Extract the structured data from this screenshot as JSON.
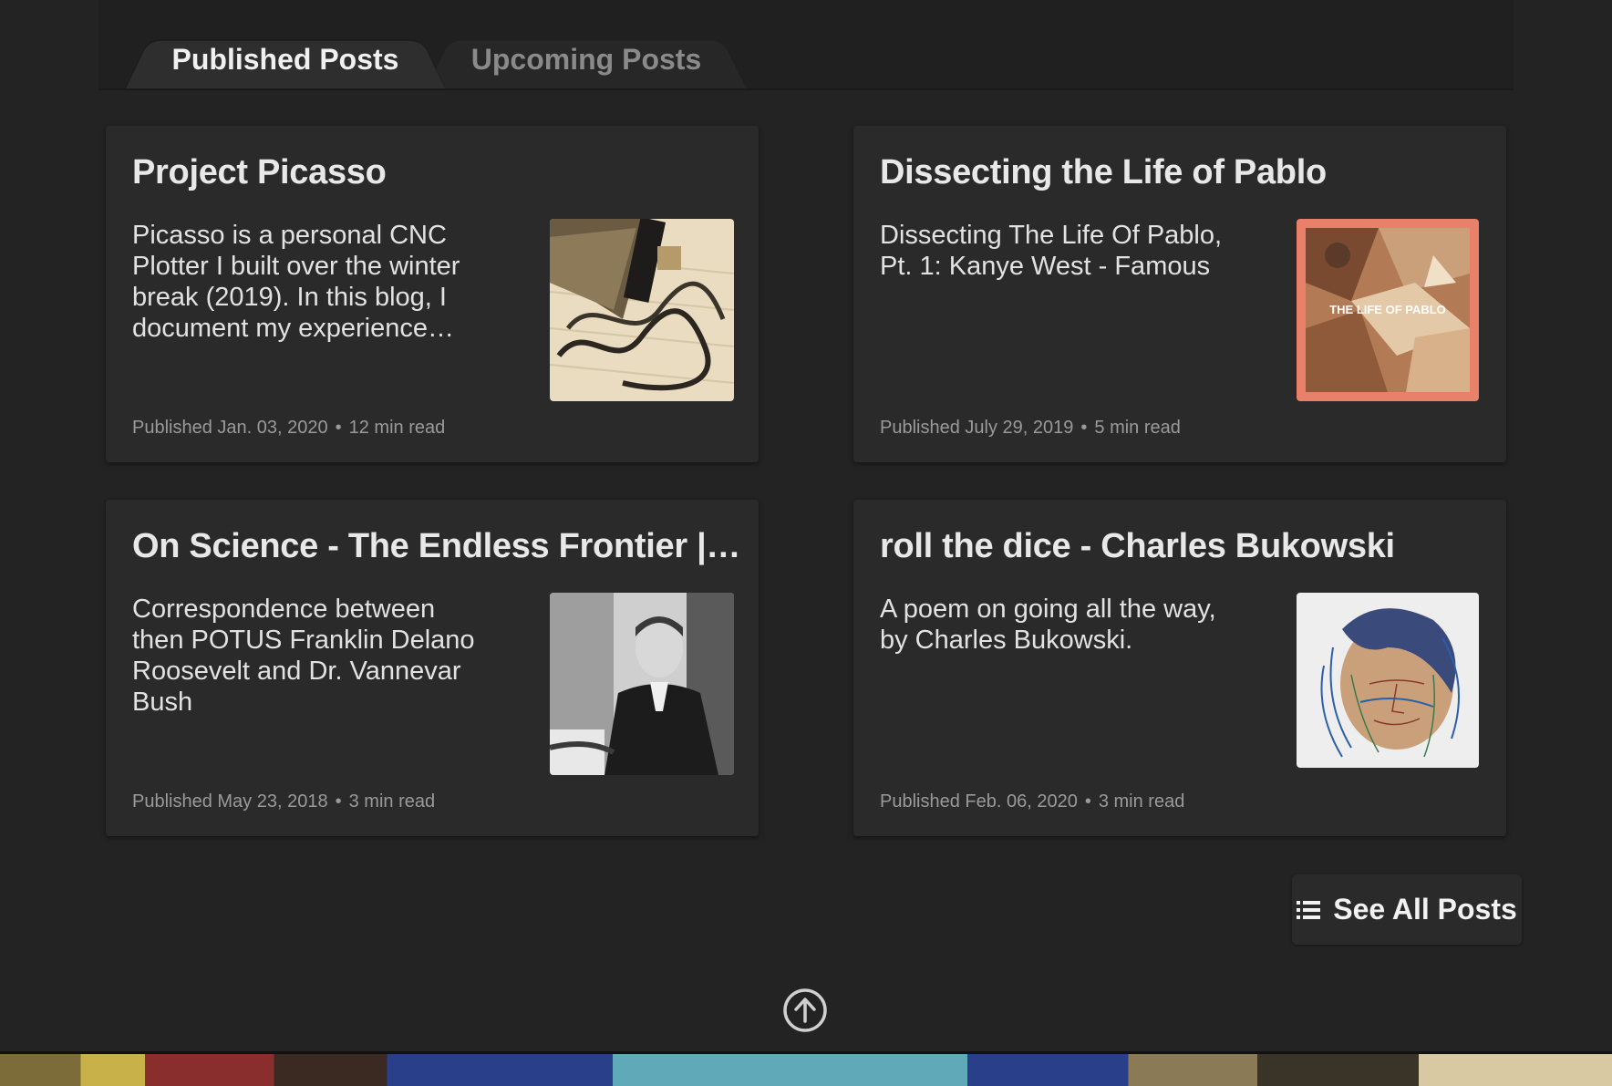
{
  "tabs": [
    {
      "label": "Published Posts",
      "active": true
    },
    {
      "label": "Upcoming Posts",
      "active": false
    }
  ],
  "posts": [
    {
      "title": "Project Picasso",
      "excerpt": "Picasso is a personal CNC Plotter I built over the winter break (2019). In this blog, I document my experience…",
      "published": "Published Jan. 03, 2020",
      "read_time": "12 min read",
      "thumbnail": "cnc-plotter-photo"
    },
    {
      "title": "Dissecting the Life of Pablo",
      "excerpt": "Dissecting The Life Of Pablo, Pt. 1: Kanye West - Famous",
      "published": "Published July 29, 2019",
      "read_time": "5 min read",
      "thumbnail": "life-of-pablo-cover",
      "thumbnail_text": "THE LIFE OF PABLO"
    },
    {
      "title": "On Science - The Endless Frontier | Pa...",
      "excerpt": "Correspondence between then POTUS Franklin Delano Roosevelt and Dr. Vannevar Bush",
      "published": "Published May 23, 2018",
      "read_time": "3 min read",
      "thumbnail": "roosevelt-portrait"
    },
    {
      "title": "roll the dice - Charles Bukowski",
      "excerpt": "A poem on going all the way, by Charles Bukowski.",
      "published": "Published Feb. 06, 2020",
      "read_time": "3 min read",
      "thumbnail": "bukowski-sketch"
    }
  ],
  "see_all": {
    "label": "See All Posts",
    "icon": "list-icon"
  },
  "scroll_top": {
    "icon": "arrow-up-circle-icon"
  },
  "colors": {
    "background": "#232323",
    "card": "#2a2a2a",
    "meta": "#9a9a9a",
    "pablo_frame": "#e8806a"
  }
}
